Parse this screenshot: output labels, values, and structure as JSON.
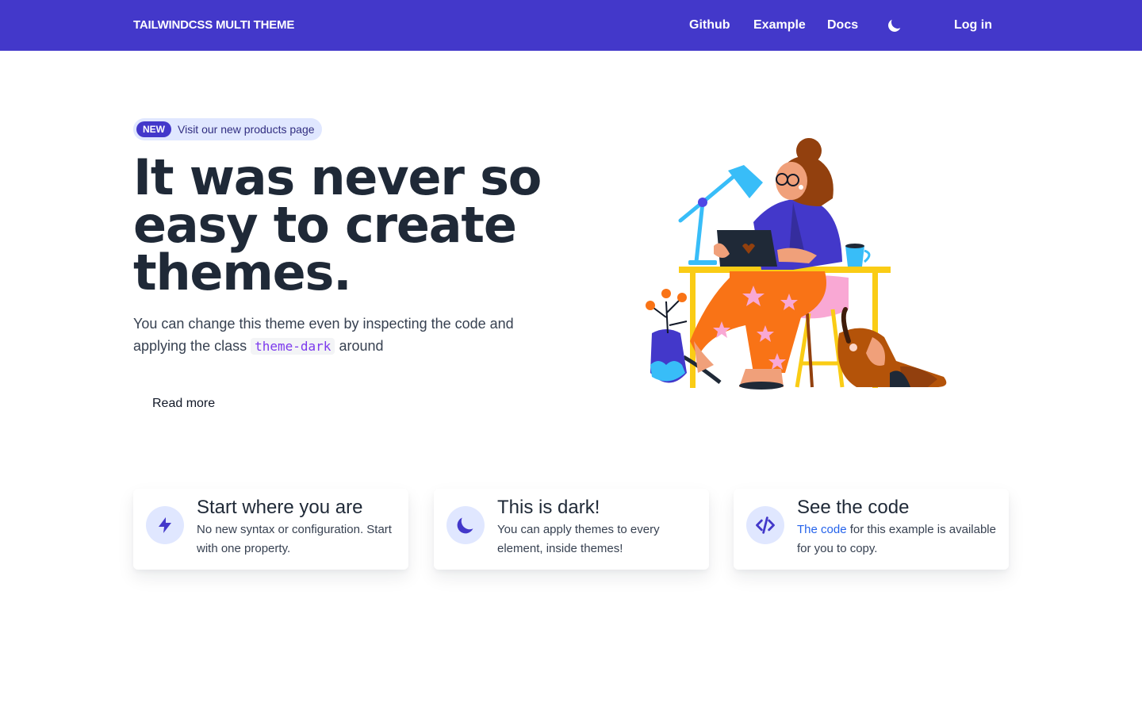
{
  "nav": {
    "brand": "TAILWINDCSS MULTI THEME",
    "links": [
      "Github",
      "Example",
      "Docs"
    ],
    "theme_icon": "moon-icon",
    "login": "Log in"
  },
  "hero": {
    "badge": {
      "label": "NEW",
      "text": "Visit our new products page"
    },
    "title": "It was never so easy to create themes.",
    "description_before": "You can change this theme even by inspecting the code and applying the class",
    "code": "theme-dark",
    "description_after": "around",
    "read_more": "Read more",
    "illustration": "woman-working-at-desk-with-dog-illustration"
  },
  "features": [
    {
      "icon": "lightning-bolt-icon",
      "title": "Start where you are",
      "text": "No new syntax or configuration. Start with one property."
    },
    {
      "icon": "moon-icon",
      "title": "This is dark!",
      "text": "You can apply themes to every element, inside themes!"
    },
    {
      "icon": "code-icon",
      "title": "See the code",
      "link_text": "The code",
      "text": "for this example is available for you to copy."
    }
  ],
  "colors": {
    "primary": "#4338ca",
    "primary_light": "#e0e7ff",
    "heading": "#1f2937",
    "code": "#7c3aed",
    "link": "#2563eb"
  }
}
